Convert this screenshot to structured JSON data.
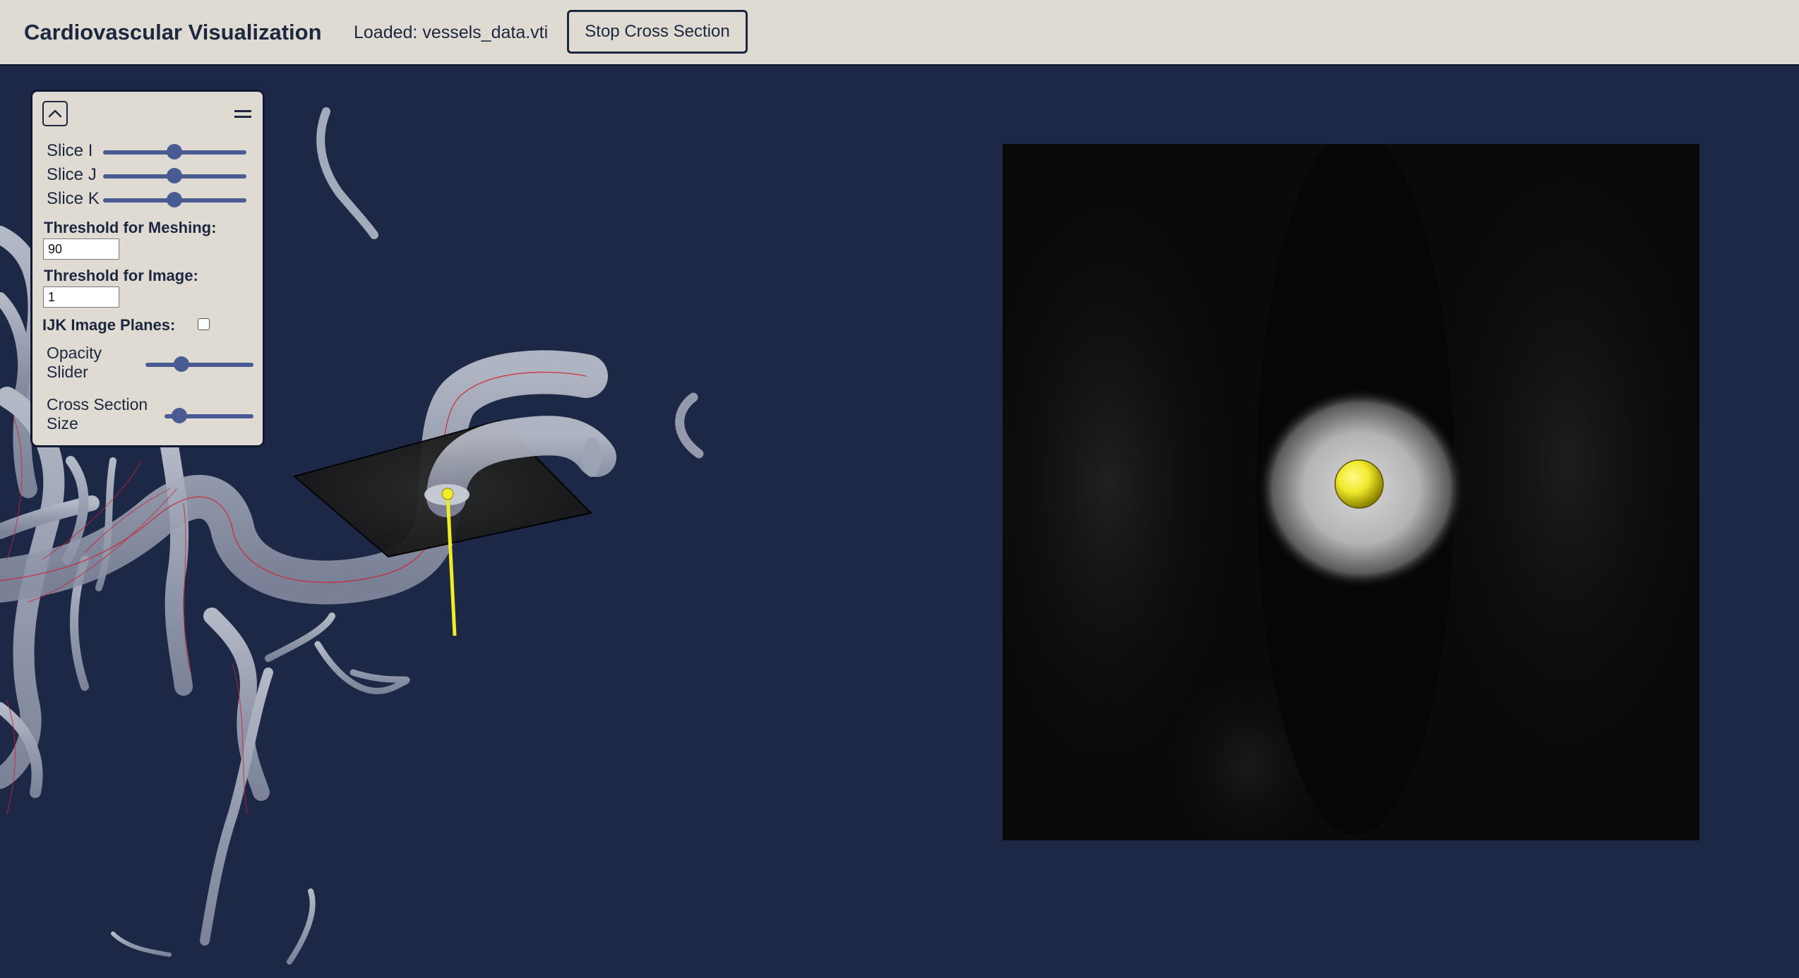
{
  "header": {
    "title": "Cardiovascular Visualization",
    "loaded_text": "Loaded: vessels_data.vti",
    "stop_button_label": "Stop Cross Section"
  },
  "panel": {
    "collapse_icon": "chevron-up-icon",
    "menu_icon": "menu-icon",
    "slice_i": {
      "label": "Slice I",
      "value": 0.5
    },
    "slice_j": {
      "label": "Slice J",
      "value": 0.5
    },
    "slice_k": {
      "label": "Slice K",
      "value": 0.5
    },
    "threshold_meshing": {
      "label": "Threshold for Meshing:",
      "value": "90"
    },
    "threshold_image": {
      "label": "Threshold for Image:",
      "value": "1"
    },
    "ijk_planes": {
      "label": "IJK Image Planes:",
      "checked": false
    },
    "opacity": {
      "label_line1": "Opacity",
      "label_line2": "Slider",
      "value": 0.33
    },
    "cross_section_size": {
      "label_line1": "Cross Section",
      "label_line2": "Size",
      "value": 0.1
    }
  },
  "colors": {
    "background": "#1c2846",
    "header_bg": "#e0dbd2",
    "accent_slider": "#4a5a92",
    "marker": "#f0ec2a",
    "centerline": "#d02030"
  }
}
